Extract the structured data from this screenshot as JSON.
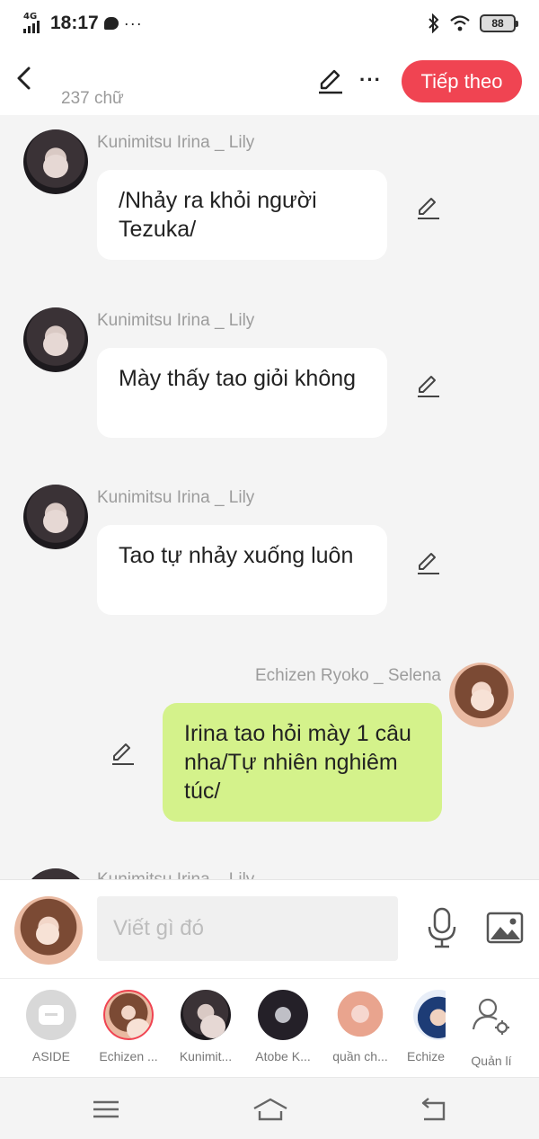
{
  "status_bar": {
    "network": "4G",
    "time": "18:17",
    "battery": "88"
  },
  "header": {
    "word_count": "237 chữ",
    "next_label": "Tiếp theo"
  },
  "messages": [
    {
      "sender": "Kunimitsu Irina _ Lily",
      "text": "/Nhảy ra khỏi người Tezuka/",
      "side": "left"
    },
    {
      "sender": "Kunimitsu Irina _ Lily",
      "text": "Mày thấy tao giỏi không",
      "side": "left"
    },
    {
      "sender": "Kunimitsu Irina _ Lily",
      "text": "Tao tự nhảy xuống luôn",
      "side": "left"
    },
    {
      "sender": "Echizen Ryoko _ Selena",
      "text": "Irina tao hỏi mày 1 câu nha/Tự nhiên nghiêm túc/",
      "side": "right"
    },
    {
      "sender": "Kunimitsu Irina _ Lily",
      "text": "",
      "side": "left"
    }
  ],
  "composer": {
    "placeholder": "Viết gì đó"
  },
  "characters": [
    {
      "name": "ASIDE"
    },
    {
      "name": "Echizen ..."
    },
    {
      "name": "Kunimit..."
    },
    {
      "name": "Atobe K..."
    },
    {
      "name": "quần ch..."
    },
    {
      "name": "Echize"
    },
    {
      "name": "Quản lí"
    }
  ],
  "colors": {
    "accent": "#f04452",
    "my_bubble": "#d4f28b",
    "other_bubble": "#ffffff",
    "background": "#f4f4f4"
  }
}
